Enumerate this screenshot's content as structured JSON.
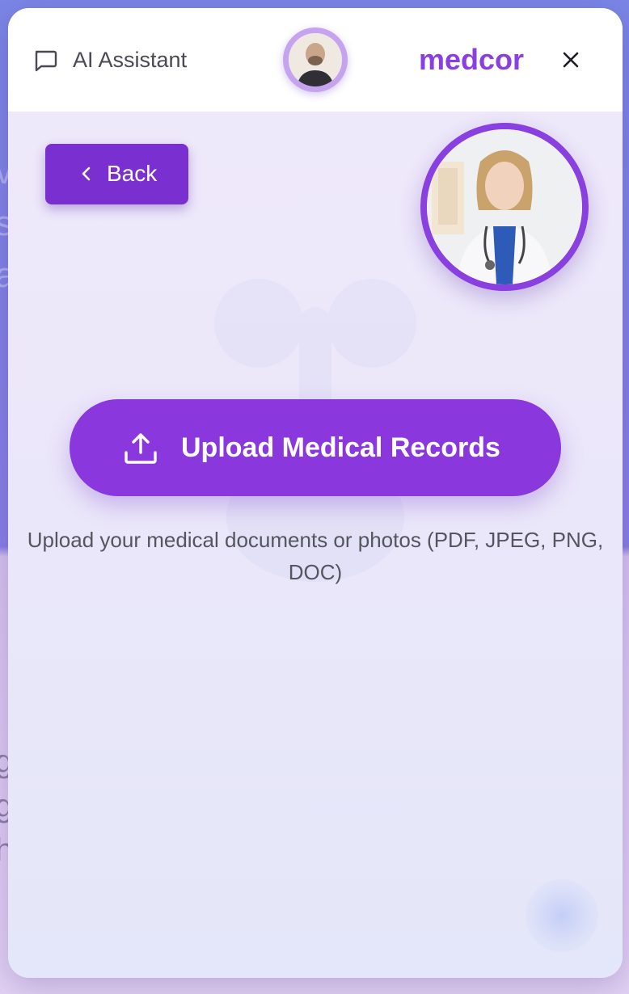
{
  "header": {
    "assistant_title": "AI Assistant",
    "brand": "medcor",
    "chat_icon": "chat-bubble-icon",
    "close_icon": "close-icon"
  },
  "back_button": {
    "label": "Back",
    "icon": "chevron-left-icon"
  },
  "upload": {
    "button_label": "Upload Medical Records",
    "icon": "upload-icon",
    "help_text": "Upload your medical documents or photos (PDF, JPEG, PNG, DOC)"
  },
  "colors": {
    "brand_purple": "#8a3fe0",
    "back_button": "#7a2fd0",
    "upload_button": "#8a38de"
  }
}
